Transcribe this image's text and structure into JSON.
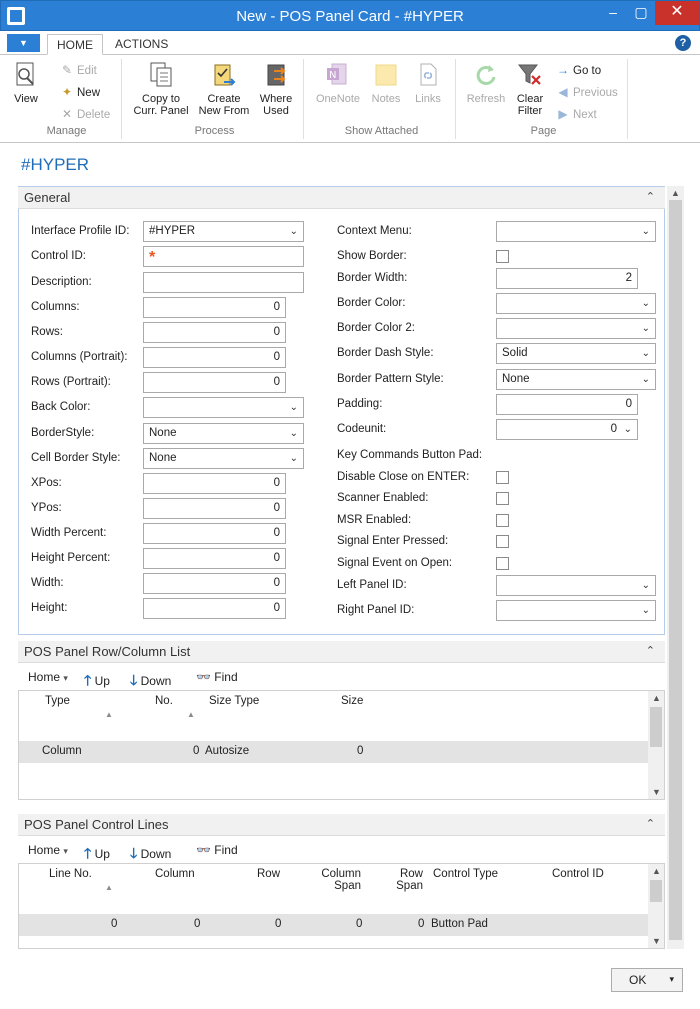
{
  "window": {
    "title": "New - POS Panel Card - #HYPER",
    "min": "‒",
    "max": "▢",
    "close": "✕"
  },
  "tabs": {
    "home": "HOME",
    "actions": "ACTIONS",
    "file_arrow": "▼",
    "help": "?"
  },
  "ribbon": {
    "manage": {
      "label": "Manage",
      "view": "View",
      "edit": "Edit",
      "new": "New",
      "delete": "Delete"
    },
    "process": {
      "label": "Process",
      "copy_line1": "Copy to",
      "copy_line2": "Curr. Panel",
      "create_line1": "Create",
      "create_line2": "New From",
      "where_line1": "Where",
      "where_line2": "Used"
    },
    "show_attached": {
      "label": "Show Attached",
      "onenote": "OneNote",
      "notes": "Notes",
      "links": "Links"
    },
    "page": {
      "label": "Page",
      "refresh": "Refresh",
      "clear_line1": "Clear",
      "clear_line2": "Filter",
      "goto": "Go to",
      "previous": "Previous",
      "next": "Next"
    }
  },
  "page_title": "#HYPER",
  "general": {
    "title": "General",
    "left": [
      {
        "label": "Interface Profile ID:",
        "value": "#HYPER",
        "kind": "select"
      },
      {
        "label": "Control ID:",
        "value": "",
        "kind": "required"
      },
      {
        "label": "Description:",
        "value": "",
        "kind": "text"
      },
      {
        "label": "Columns:",
        "value": "0",
        "kind": "num"
      },
      {
        "label": "Rows:",
        "value": "0",
        "kind": "num"
      },
      {
        "label": "Columns (Portrait):",
        "value": "0",
        "kind": "num"
      },
      {
        "label": "Rows (Portrait):",
        "value": "0",
        "kind": "num"
      },
      {
        "label": "Back Color:",
        "value": "",
        "kind": "select"
      },
      {
        "label": "BorderStyle:",
        "value": "None",
        "kind": "select"
      },
      {
        "label": "Cell Border Style:",
        "value": "None",
        "kind": "select"
      },
      {
        "label": "XPos:",
        "value": "0",
        "kind": "num"
      },
      {
        "label": "YPos:",
        "value": "0",
        "kind": "num"
      },
      {
        "label": "Width Percent:",
        "value": "0",
        "kind": "num"
      },
      {
        "label": "Height Percent:",
        "value": "0",
        "kind": "num"
      },
      {
        "label": "Width:",
        "value": "0",
        "kind": "num"
      },
      {
        "label": "Height:",
        "value": "0",
        "kind": "num"
      }
    ],
    "right": [
      {
        "label": "Context Menu:",
        "value": "",
        "kind": "select"
      },
      {
        "label": "Show Border:",
        "value": "",
        "kind": "check"
      },
      {
        "label": "Border Width:",
        "value": "2",
        "kind": "num"
      },
      {
        "label": "Border Color:",
        "value": "",
        "kind": "select"
      },
      {
        "label": "Border Color 2:",
        "value": "",
        "kind": "select"
      },
      {
        "label": "Border Dash Style:",
        "value": "Solid",
        "kind": "select"
      },
      {
        "label": "Border Pattern Style:",
        "value": "None",
        "kind": "select"
      },
      {
        "label": "Padding:",
        "value": "0",
        "kind": "num"
      },
      {
        "label": "Codeunit:",
        "value": "0",
        "kind": "numselect"
      },
      {
        "label": "Key Commands Button Pad:",
        "value": "",
        "kind": "none"
      },
      {
        "label": "Disable Close on ENTER:",
        "value": "",
        "kind": "check"
      },
      {
        "label": "Scanner Enabled:",
        "value": "",
        "kind": "check"
      },
      {
        "label": "MSR Enabled:",
        "value": "",
        "kind": "check"
      },
      {
        "label": "Signal Enter Pressed:",
        "value": "",
        "kind": "check"
      },
      {
        "label": "Signal Event on Open:",
        "value": "",
        "kind": "check"
      },
      {
        "label": "Left Panel ID:",
        "value": "",
        "kind": "select"
      },
      {
        "label": "Right Panel ID:",
        "value": "",
        "kind": "select"
      }
    ]
  },
  "rowcol_list": {
    "title": "POS Panel Row/Column List",
    "toolbar": {
      "home": "Home",
      "up": "Up",
      "down": "Down",
      "find": "Find"
    },
    "headers": {
      "type": "Type",
      "no": "No.",
      "size_type": "Size Type",
      "size": "Size"
    },
    "rows": [
      {
        "type": "Column",
        "no": "0",
        "size_type": "Autosize",
        "size": "0"
      }
    ]
  },
  "control_lines": {
    "title": "POS Panel Control Lines",
    "toolbar": {
      "home": "Home",
      "up": "Up",
      "down": "Down",
      "find": "Find"
    },
    "headers": {
      "line_no": "Line No.",
      "column": "Column",
      "row": "Row",
      "column_span_1": "Column",
      "column_span_2": "Span",
      "row_span_1": "Row",
      "row_span_2": "Span",
      "control_type": "Control Type",
      "control_id": "Control ID"
    },
    "rows": [
      {
        "line_no": "0",
        "column": "0",
        "row": "0",
        "column_span": "0",
        "row_span": "0",
        "control_type": "Button Pad",
        "control_id": ""
      }
    ]
  },
  "footer": {
    "ok": "OK"
  },
  "colors": {
    "accent": "#2b7fd4",
    "close": "#c9312b",
    "title_text": "#1f6db8",
    "required": "#e8531f"
  }
}
